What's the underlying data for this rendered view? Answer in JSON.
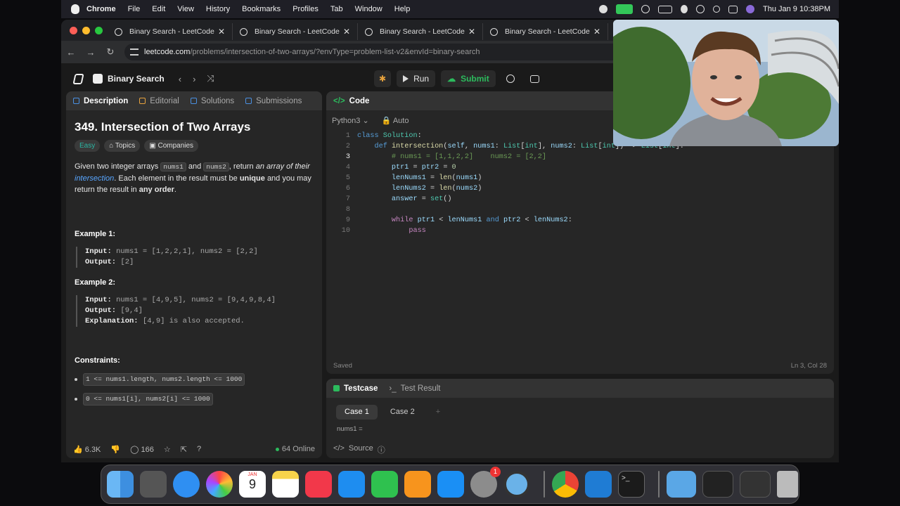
{
  "menubar": {
    "app": "Chrome",
    "items": [
      "File",
      "Edit",
      "View",
      "History",
      "Bookmarks",
      "Profiles",
      "Tab",
      "Window",
      "Help"
    ],
    "datetime": "Thu Jan 9  10:38PM"
  },
  "tabs": [
    {
      "title": "Binary Search - LeetCode"
    },
    {
      "title": "Binary Search - LeetCode"
    },
    {
      "title": "Binary Search - LeetCode"
    },
    {
      "title": "Binary Search - LeetCode"
    }
  ],
  "url": {
    "host": "leetcode.com",
    "path": "/problems/intersection-of-two-arrays/?envType=problem-list-v2&envId=binary-search"
  },
  "topbar": {
    "problem_list": "Binary Search",
    "run": "Run",
    "submit": "Submit"
  },
  "left_tabs": [
    "Description",
    "Editorial",
    "Solutions",
    "Submissions"
  ],
  "problem": {
    "title": "349. Intersection of Two Arrays",
    "difficulty": "Easy",
    "topics": "Topics",
    "companies": "Companies",
    "p1": "Given two integer arrays",
    "nums1": "nums1",
    "and": "and",
    "nums2": "nums2",
    "p2": ", return",
    "p3": "an array of their",
    "p4": "intersection",
    "p5": ". Each element in the result must be",
    "unique": "unique",
    "p6": "and you may return the result in",
    "anyorder": "any order",
    "period": ".",
    "ex1_title": "Example 1:",
    "ex1_in_label": "Input:",
    "ex1_in": "nums1 = [1,2,2,1], nums2 = [2,2]",
    "ex1_out_label": "Output:",
    "ex1_out": "[2]",
    "ex2_title": "Example 2:",
    "ex2_in_label": "Input:",
    "ex2_in": "nums1 = [4,9,5], nums2 = [9,4,9,8,4]",
    "ex2_out_label": "Output:",
    "ex2_out": "[9,4]",
    "ex2_exp_label": "Explanation:",
    "ex2_exp": "[4,9] is also accepted.",
    "constraints_title": "Constraints:",
    "c1": "1 <= nums1.length, nums2.length <= 1000",
    "c2": "0 <= nums1[i], nums2[i] <= 1000"
  },
  "left_footer": {
    "likes": "6.3K",
    "comments": "166",
    "online": "64 Online"
  },
  "code_panel": {
    "title": "Code",
    "language": "Python3",
    "mode": "Auto",
    "saved": "Saved",
    "cursor": "Ln 3, Col 28"
  },
  "code_lines": [
    "1",
    "2",
    "3",
    "4",
    "5",
    "6",
    "7",
    "8",
    "9",
    "10"
  ],
  "testcase": {
    "tab1": "Testcase",
    "tab2": "Test Result",
    "case1": "Case 1",
    "case2": "Case 2",
    "add": "+",
    "nums1_label": "nums1 =",
    "source": "Source"
  },
  "dock": {
    "calendar_month": "JAN",
    "calendar_day": "9",
    "settings_badge": "1"
  }
}
